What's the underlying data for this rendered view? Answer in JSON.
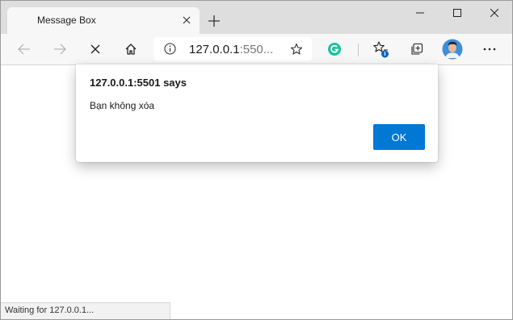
{
  "tab": {
    "title": "Message Box",
    "close_icon": "close-icon"
  },
  "toolbar": {
    "address_host": "127.0.0.1",
    "address_port": ":550...",
    "icons": [
      "back-arrow-icon",
      "forward-arrow-icon",
      "stop-icon",
      "home-icon",
      "info-icon",
      "favorite-star-icon",
      "grammarly-icon",
      "favorites-list-icon",
      "collections-icon",
      "profile-avatar",
      "more-icon"
    ]
  },
  "dialog": {
    "title": "127.0.0.1:5501 says",
    "message": "Bạn không xóa",
    "ok_label": "OK"
  },
  "status": {
    "text": "Waiting for 127.0.0.1..."
  },
  "colors": {
    "accent": "#0078d4",
    "grammarly": "#15c39a",
    "badge": "#0a62c9"
  }
}
